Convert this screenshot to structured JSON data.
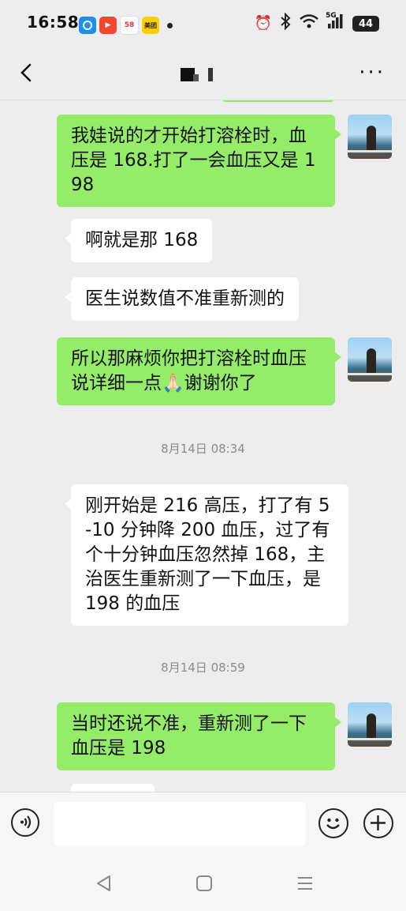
{
  "status_bar": {
    "time": "16:58",
    "apps": [
      {
        "name": "app-icon-blue",
        "color": "#1e8ef0",
        "label": ""
      },
      {
        "name": "app-icon-red",
        "color": "#f04632",
        "label": "▶"
      },
      {
        "name": "app-icon-58",
        "color": "#ffffff",
        "label": "58"
      },
      {
        "name": "app-icon-meituan",
        "color": "#ffd000",
        "label": "美团"
      }
    ],
    "battery": "44",
    "network": "5G"
  },
  "header": {
    "title": ""
  },
  "messages": [
    {
      "side": "out",
      "text": "我娃说的才开始打溶栓时，血压是 168.打了一会血压又是 198"
    },
    {
      "side": "in",
      "text": "啊就是那 168"
    },
    {
      "side": "in",
      "text": "医生说数值不准重新测的"
    },
    {
      "side": "out",
      "text": "所以那麻烦你把打溶栓时血压说详细一点🙏🏻谢谢你了"
    },
    {
      "side": "time",
      "text": "8月14日 08:34"
    },
    {
      "side": "in",
      "text": "刚开始是 216 高压，打了有 5-10 分钟降 200 血压，过了有个十分钟血压忽然掉 168，主治医生重新测了一下血压，是 198 的血压"
    },
    {
      "side": "time",
      "text": "8月14日 08:59"
    },
    {
      "side": "out",
      "text": "当时还说不准，重新测了一下血压是 198"
    }
  ],
  "input": {
    "value": "",
    "placeholder": ""
  },
  "colors": {
    "outgoing_bubble": "#95ec69",
    "incoming_bubble": "#ffffff",
    "background": "#ededed"
  },
  "icons": [
    "back-arrow-icon",
    "more-icon",
    "voice-icon",
    "emoji-icon",
    "plus-icon",
    "nav-back-icon",
    "nav-home-icon",
    "nav-menu-icon"
  ]
}
